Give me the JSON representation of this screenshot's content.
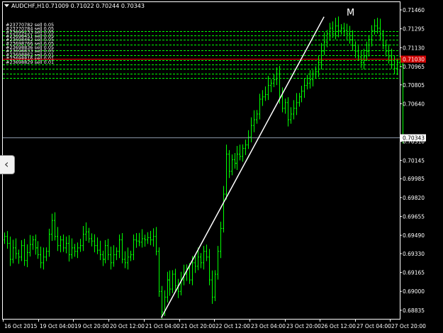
{
  "header": {
    "dropdown_icon": "triangle-down-icon",
    "symbol_tf": "AUDCHF,H1",
    "ohlc": "0.71009 0.71022 0.70244 0.70343"
  },
  "annotation": "M",
  "collapse_icon": "chevron-left-icon",
  "colors": {
    "background": "#000000",
    "candle": "#00ff00",
    "frame": "#ffffff",
    "order_line": "#00ff00",
    "entry_line": "#ff0000",
    "price_line": "#8a95a8",
    "trendline": "#ffffff",
    "entry_label_bg": "#d00000",
    "price_label_bg": "#ffffff"
  },
  "orders": [
    {
      "label": "#23770782 sell 0.05",
      "price": 0.71275
    },
    {
      "label": "#23770784 sell 0.05",
      "price": 0.7124
    },
    {
      "label": "#23699233 sell 0.05",
      "price": 0.712
    },
    {
      "label": "#23698451 sell 0.05",
      "price": 0.71155
    },
    {
      "label": "#23698462 sell 0.05",
      "price": 0.7111
    },
    {
      "label": "#23698766 sell 0.05",
      "price": 0.71065
    },
    {
      "label": "#23698836 sell 0.05",
      "price": 0.7102
    },
    {
      "label": "#23698833 sell 0.05",
      "price": 0.70985
    },
    {
      "label": "#23698862 sell 0.01",
      "price": 0.70945
    },
    {
      "label": "#23698816 sell 0.01",
      "price": 0.70905
    },
    {
      "label": "#23698829 sell 0.01",
      "price": 0.70865
    }
  ],
  "entry_price": 0.7103,
  "entry_label": "0.71030",
  "current_price": 0.70343,
  "current_label": "0.70343",
  "chart_data": {
    "type": "candlestick",
    "symbol": "AUDCHF",
    "timeframe": "H1",
    "ylim": [
      0.68835,
      0.7138
    ],
    "y_ticks": [
      "0.71460",
      "0.71295",
      "0.71130",
      "0.70965",
      "0.70805",
      "0.70640",
      "0.70310",
      "0.70145",
      "0.69985",
      "0.69820",
      "0.69655",
      "0.69490",
      "0.69330",
      "0.69165",
      "0.69000",
      "0.68835"
    ],
    "x_ticks": [
      "16 Oct 2015",
      "19 Oct 04:00",
      "19 Oct 20:00",
      "20 Oct 12:00",
      "21 Oct 04:00",
      "21 Oct 20:00",
      "22 Oct 12:00",
      "23 Oct 04:00",
      "23 Oct 20:00",
      "26 Oct 12:00",
      "27 Oct 04:00",
      "27 Oct 20:00"
    ],
    "trendline": {
      "from": {
        "bar": 56,
        "price": 0.6877
      },
      "to": {
        "bar": 114,
        "price": 0.714
      }
    },
    "closes": [
      0.6948,
      0.6942,
      0.6928,
      0.6938,
      0.6933,
      0.693,
      0.694,
      0.6927,
      0.6934,
      0.6941,
      0.6945,
      0.6938,
      0.6932,
      0.6925,
      0.693,
      0.6935,
      0.695,
      0.6962,
      0.6948,
      0.694,
      0.6945,
      0.6938,
      0.6942,
      0.6932,
      0.6938,
      0.6935,
      0.6938,
      0.694,
      0.695,
      0.6952,
      0.6946,
      0.6944,
      0.694,
      0.6936,
      0.6932,
      0.6928,
      0.694,
      0.6932,
      0.6925,
      0.6932,
      0.6935,
      0.6945,
      0.6928,
      0.6925,
      0.693,
      0.6932,
      0.6945,
      0.6944,
      0.6943,
      0.6946,
      0.6945,
      0.6947,
      0.6945,
      0.6948,
      0.6935,
      0.69,
      0.6882,
      0.6895,
      0.691,
      0.6902,
      0.6915,
      0.6905,
      0.69,
      0.691,
      0.6915,
      0.692,
      0.691,
      0.6925,
      0.6922,
      0.693,
      0.6925,
      0.6935,
      0.693,
      0.691,
      0.6895,
      0.6915,
      0.6935,
      0.6955,
      0.6985,
      0.702,
      0.7005,
      0.7015,
      0.7012,
      0.702,
      0.7018,
      0.7025,
      0.7028,
      0.7035,
      0.7045,
      0.705,
      0.7055,
      0.7068,
      0.707,
      0.7072,
      0.708,
      0.7082,
      0.7085,
      0.709,
      0.707,
      0.706,
      0.7065,
      0.705,
      0.7055,
      0.706,
      0.7065,
      0.707,
      0.7075,
      0.708,
      0.7082,
      0.7085,
      0.709,
      0.7092,
      0.71,
      0.711,
      0.7118,
      0.7125,
      0.713,
      0.7125,
      0.7132,
      0.7128,
      0.713,
      0.7128,
      0.7125,
      0.712,
      0.7115,
      0.711,
      0.7105,
      0.71,
      0.7105,
      0.711,
      0.712,
      0.7128,
      0.7132,
      0.713,
      0.7125,
      0.7115,
      0.711,
      0.7105,
      0.7098,
      0.7095,
      0.71,
      0.7098,
      0.7034
    ]
  }
}
